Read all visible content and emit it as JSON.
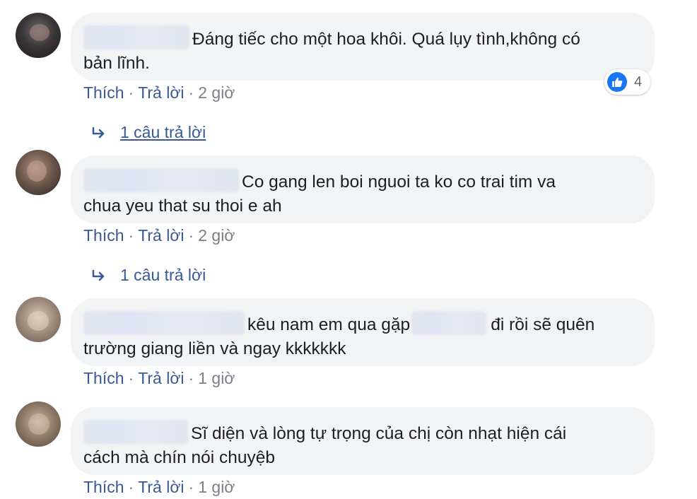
{
  "comments": [
    {
      "text_line1": "Đáng tiếc cho một hoa khôi. Quá lụy tình,không có",
      "text_line2": "bản lĩnh.",
      "reaction_count": "4",
      "like_label": "Thích",
      "reply_label": "Trả lời",
      "time": "2 giờ",
      "replies_label": "1 câu trả lời"
    },
    {
      "text_line1": "Co gang len boi nguoi ta ko co trai tim va",
      "text_line2": "chua yeu that su thoi e ah",
      "like_label": "Thích",
      "reply_label": "Trả lời",
      "time": "2 giờ",
      "replies_label": "1 câu trả lời"
    },
    {
      "text_part1": "kêu nam em qua gặp",
      "text_part2": "đi rồi sẽ quên",
      "text_line2": "trường giang liền và ngay kkkkkkk",
      "like_label": "Thích",
      "reply_label": "Trả lời",
      "time": "1 giờ"
    },
    {
      "text_line1": "Sĩ diện và lòng tự trọng của chị còn nhạt hiện cái",
      "text_line2": "cách mà chín nói chuyệb",
      "like_label": "Thích",
      "reply_label": "Trả lời",
      "time": "1 giờ"
    }
  ],
  "colors": {
    "link": "#385898",
    "meta": "#7b7f86",
    "bubble": "#f2f3f5",
    "like_blue": "#1877f2"
  },
  "icons": {
    "reply_arrow": "reply-arrow-icon",
    "like": "thumbs-up-icon"
  }
}
